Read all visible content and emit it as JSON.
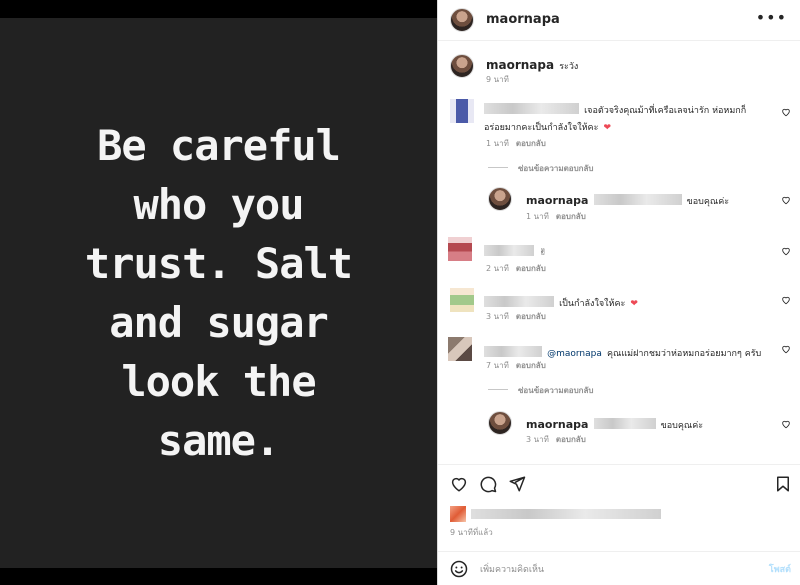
{
  "post": {
    "quote_lines": [
      "Be careful",
      "who you",
      "trust. Salt",
      "and sugar",
      "look the",
      "same."
    ]
  },
  "header": {
    "username": "maornapa",
    "more": "•••"
  },
  "caption": {
    "username": "maornapa",
    "text": "ระวัง",
    "time": "9 นาที"
  },
  "comments": [
    {
      "text_line1": "เจอตัวจริงคุณม้าที่เครือเลจน่ารัก ห่อหมกก็",
      "text_line2": "อร่อยมากคะเป็นกำลังใจให้คะ",
      "heart": "❤",
      "time": "1 นาที",
      "reply": "ตอบกลับ",
      "hide_replies": "ซ่อนข้อความตอบกลับ",
      "reply_item": {
        "username": "maornapa",
        "text": "ขอบคุณค่ะ",
        "time": "1 นาที",
        "reply": "ตอบกลับ"
      }
    },
    {
      "text": "✌",
      "time": "2 นาที",
      "reply": "ตอบกลับ"
    },
    {
      "text": "เป็นกำลังใจให้คะ",
      "heart": "❤",
      "time": "3 นาที",
      "reply": "ตอบกลับ"
    },
    {
      "mention": "@maornapa",
      "text": "คุณแม่ฝากชมว่าห่อหมกอร่อยมากๆ ครับ",
      "time": "7 นาที",
      "reply": "ตอบกลับ",
      "hide_replies": "ซ่อนข้อความตอบกลับ",
      "reply_item": {
        "username": "maornapa",
        "text": "ขอบคุณค่ะ",
        "time": "3 นาที",
        "reply": "ตอบกลับ"
      }
    }
  ],
  "footer": {
    "time_ago": "9 นาทีที่แล้ว",
    "add_comment_placeholder": "เพิ่มความคิดเห็น",
    "post_button": "โพสต์"
  },
  "colors": {
    "accent_disabled": "#b2dffc",
    "heart_red": "#ed4956",
    "mention": "#00376b"
  }
}
